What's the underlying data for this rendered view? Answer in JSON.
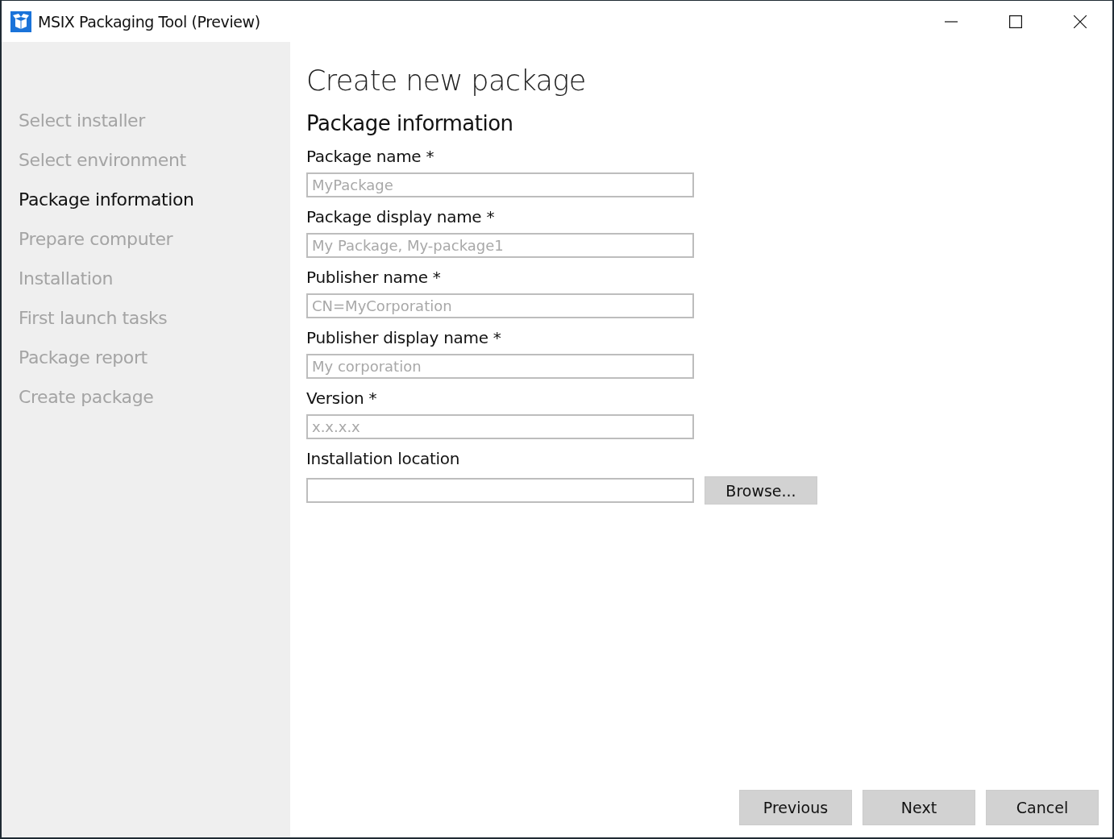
{
  "window": {
    "title": "MSIX Packaging Tool (Preview)"
  },
  "steps": [
    {
      "label": "Select installer",
      "selected": false
    },
    {
      "label": "Select environment",
      "selected": false
    },
    {
      "label": "Package information",
      "selected": true
    },
    {
      "label": "Prepare computer",
      "selected": false
    },
    {
      "label": "Installation",
      "selected": false
    },
    {
      "label": "First launch tasks",
      "selected": false
    },
    {
      "label": "Package report",
      "selected": false
    },
    {
      "label": "Create package",
      "selected": false
    }
  ],
  "page": {
    "title": "Create new package",
    "section": "Package information"
  },
  "fields": [
    {
      "kind": "text",
      "label": "Package name *",
      "placeholder": "MyPackage"
    },
    {
      "kind": "text",
      "label": "Package display name *",
      "placeholder": "My Package, My-package1"
    },
    {
      "kind": "text",
      "label": "Publisher name *",
      "placeholder": "CN=MyCorporation"
    },
    {
      "kind": "text",
      "label": "Publisher display name *",
      "placeholder": "My corporation"
    },
    {
      "kind": "text",
      "label": "Version *",
      "placeholder": "x.x.x.x"
    },
    {
      "kind": "browse",
      "label": "Installation location",
      "button": "Browse..."
    }
  ],
  "buttons": [
    "Previous",
    "Next",
    "Cancel"
  ]
}
